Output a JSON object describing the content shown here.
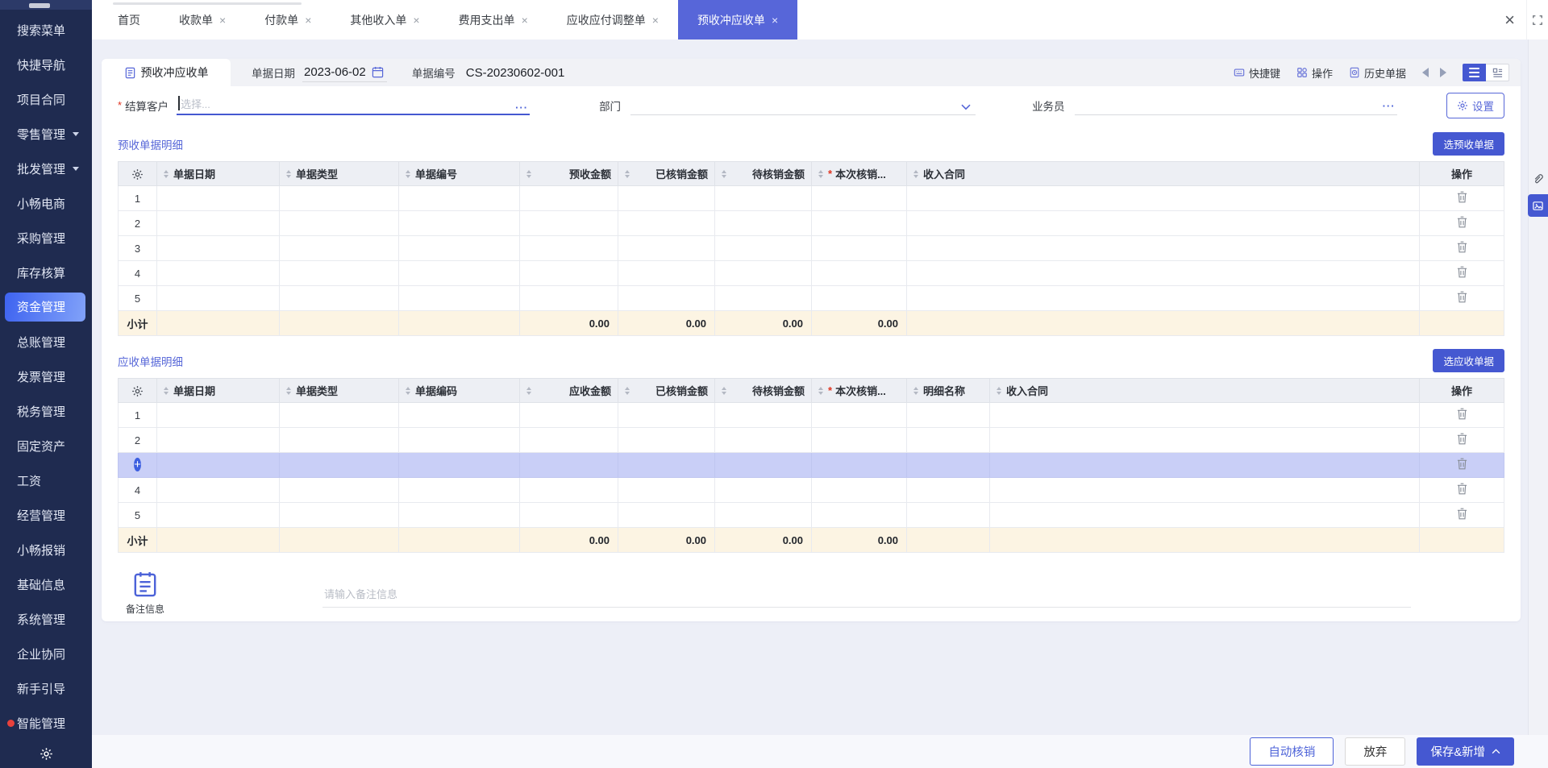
{
  "misc": {
    "required_mark": "*"
  },
  "icons": {
    "more": "···",
    "close": "×",
    "plus": "+"
  },
  "sidebar": {
    "items": [
      {
        "label": "搜索菜单"
      },
      {
        "label": "快捷导航"
      },
      {
        "label": "项目合同"
      },
      {
        "label": "零售管理"
      },
      {
        "label": "批发管理"
      },
      {
        "label": "小畅电商"
      },
      {
        "label": "采购管理"
      },
      {
        "label": "库存核算"
      },
      {
        "label": "资金管理"
      },
      {
        "label": "总账管理"
      },
      {
        "label": "发票管理"
      },
      {
        "label": "税务管理"
      },
      {
        "label": "固定资产"
      },
      {
        "label": "工资"
      },
      {
        "label": "经营管理"
      },
      {
        "label": "小畅报销"
      },
      {
        "label": "基础信息"
      },
      {
        "label": "系统管理"
      },
      {
        "label": "企业协同"
      },
      {
        "label": "新手引导"
      },
      {
        "label": "智能管理"
      }
    ]
  },
  "tabs": {
    "items": [
      {
        "label": "首页"
      },
      {
        "label": "收款单"
      },
      {
        "label": "付款单"
      },
      {
        "label": "其他收入单"
      },
      {
        "label": "费用支出单"
      },
      {
        "label": "应收应付调整单"
      },
      {
        "label": "预收冲应收单"
      }
    ]
  },
  "card": {
    "form_tab_label": "预收冲应收单",
    "date_label": "单据日期",
    "date_value": "2023-06-02",
    "number_label": "单据编号",
    "number_value": "CS-20230602-001",
    "toolbar": {
      "shortcut": "快捷键",
      "actions": "操作",
      "history": "历史单据"
    }
  },
  "form": {
    "customer_label": "结算客户",
    "customer_placeholder": "选择...",
    "department_label": "部门",
    "salesman_label": "业务员",
    "settings_label": "设置"
  },
  "t1": {
    "title": "预收单据明细",
    "select_button": "选预收单据",
    "cols": [
      "单据日期",
      "单据类型",
      "单据编号",
      "预收金额",
      "已核销金额",
      "待核销金额",
      "本次核销...",
      "收入合同"
    ],
    "action_col": "操作",
    "rows": [
      "1",
      "2",
      "3",
      "4",
      "5"
    ],
    "subtotal_label": "小计",
    "subtotals": [
      "0.00",
      "0.00",
      "0.00",
      "0.00"
    ]
  },
  "t2": {
    "title": "应收单据明细",
    "select_button": "选应收单据",
    "cols": [
      "单据日期",
      "单据类型",
      "单据编码",
      "应收金额",
      "已核销金额",
      "待核销金额",
      "本次核销...",
      "明细名称",
      "收入合同"
    ],
    "action_col": "操作",
    "rows": [
      "1",
      "2",
      "4",
      "5"
    ],
    "subtotal_label": "小计",
    "subtotals": [
      "0.00",
      "0.00",
      "0.00",
      "0.00"
    ]
  },
  "remark": {
    "label": "备注信息",
    "placeholder": "请输入备注信息"
  },
  "footer": {
    "auto": "自动核销",
    "discard": "放弃",
    "save": "保存&新增"
  },
  "colors": {
    "accent": "#4558d1",
    "tab_active": "#5766d9",
    "sidebar_bg": "#1f2b50",
    "sidebar_active_gradient": "#3e63f0",
    "subtotal_bg": "#fcf4e3",
    "highlight_row": "#c9cff7",
    "section_title": "#5767d8",
    "required": "#e0331f"
  }
}
